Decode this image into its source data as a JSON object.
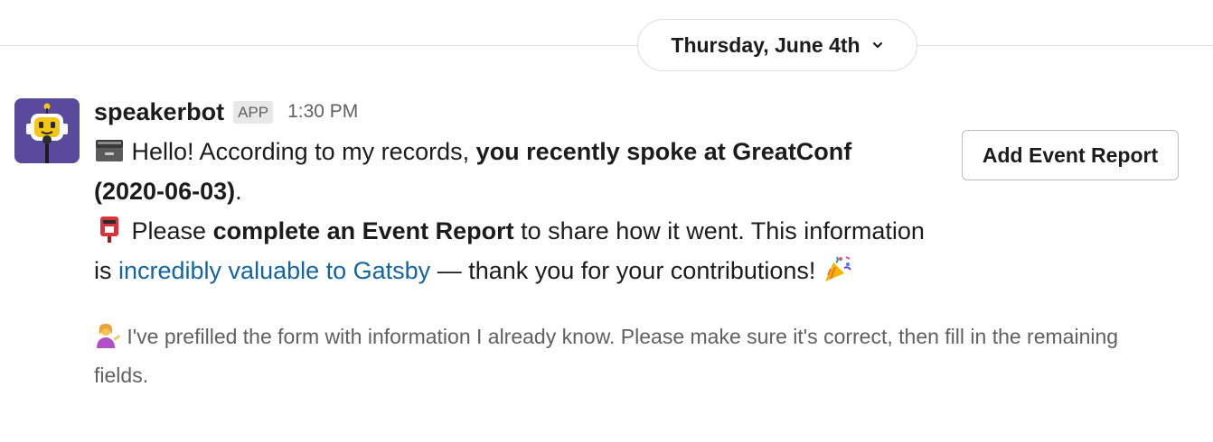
{
  "colors": {
    "link": "#1264a3",
    "avatar_bg": "#5a4a9e",
    "muted_text": "#616061",
    "divider": "#dddddd"
  },
  "date_divider": {
    "label": "Thursday, June 4th",
    "icon": "chevron-down-icon"
  },
  "message": {
    "sender": "speakerbot",
    "badge": "APP",
    "time": "1:30 PM",
    "avatar_icon": "robot-speaker-avatar",
    "line1": {
      "emoji": "card-file-box-emoji",
      "text_a": "Hello! According to my records, ",
      "bold": "you recently spoke at GreatConf (2020-06-03)",
      "text_b": "."
    },
    "line2": {
      "emoji": "postbox-emoji",
      "text_a": "Please ",
      "bold": "complete an Event Report",
      "text_b": " to share how it went. This information is ",
      "link": "incredibly valuable to Gatsby",
      "text_c": " — thank you for your contributions! ",
      "end_emoji": "party-popper-emoji"
    },
    "context": {
      "emoji": "person-tipping-hand-emoji",
      "text": "I've prefilled the form with information I already know. Please make sure it's correct, then fill in the remaining fields."
    },
    "button_label": "Add Event Report"
  }
}
